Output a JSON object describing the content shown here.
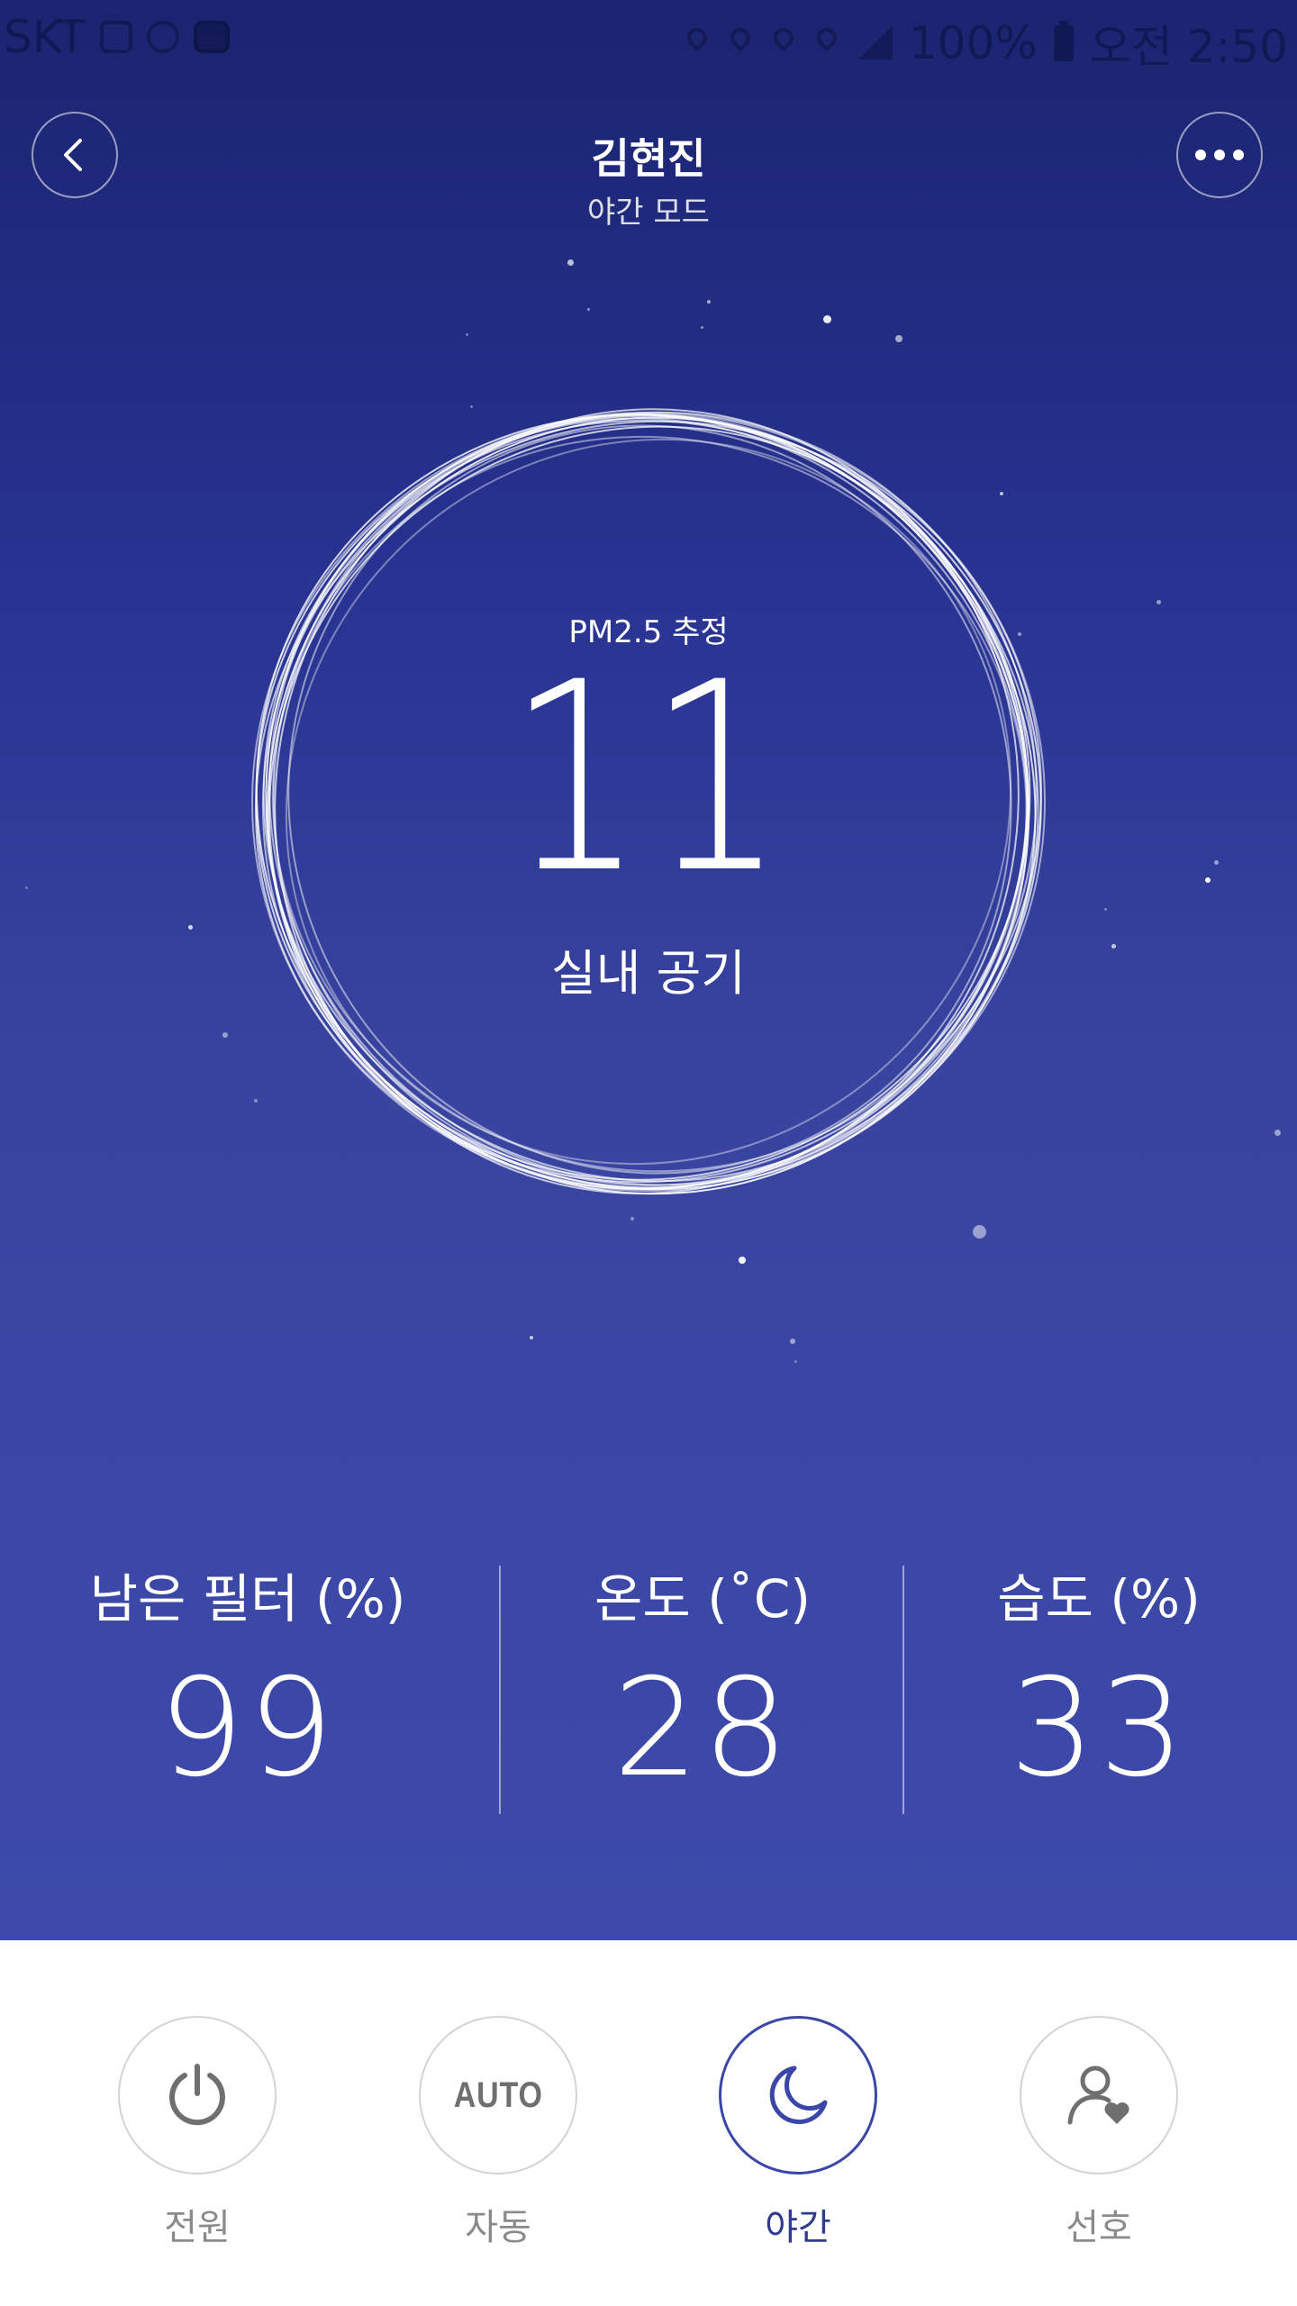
{
  "status_bar": {
    "carrier": "SKT",
    "battery": "100%",
    "time": "오전 2:50"
  },
  "header": {
    "title": "김현진",
    "subtitle": "야간 모드"
  },
  "main": {
    "pm_label": "PM2.5 추정",
    "pm_value": "11",
    "air_label": "실내 공기"
  },
  "stats": [
    {
      "label": "남은 필터 (%)",
      "value": "99"
    },
    {
      "label": "온도 (˚C)",
      "value": "28"
    },
    {
      "label": "습도 (%)",
      "value": "33"
    }
  ],
  "controls": [
    {
      "label": "전원",
      "icon": "power-icon",
      "active": false
    },
    {
      "label": "자동",
      "icon": "auto-icon",
      "icon_text": "AUTO",
      "active": false
    },
    {
      "label": "야간",
      "icon": "moon-icon",
      "active": true
    },
    {
      "label": "선호",
      "icon": "user-heart-icon",
      "active": false
    }
  ],
  "colors": {
    "background_top": "#1b2470",
    "background_bottom": "#3d4aab",
    "active_accent": "#3a46a8",
    "inactive_text": "#8a8a8a"
  }
}
